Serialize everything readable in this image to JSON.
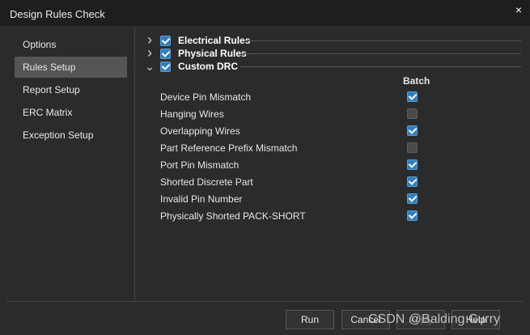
{
  "window": {
    "title": "Design Rules Check",
    "close_glyph": "×"
  },
  "sidebar": {
    "items": [
      {
        "label": "Options"
      },
      {
        "label": "Rules Setup",
        "selected": true
      },
      {
        "label": "Report Setup"
      },
      {
        "label": "ERC Matrix"
      },
      {
        "label": "Exception Setup"
      }
    ]
  },
  "tree": [
    {
      "label": "Electrical Rules",
      "expanded": false,
      "checked": true
    },
    {
      "label": "Physical Rules",
      "expanded": false,
      "checked": true
    },
    {
      "label": "Custom DRC",
      "expanded": true,
      "checked": true
    }
  ],
  "batch_header": "Batch",
  "rules": [
    {
      "label": "Device Pin Mismatch",
      "batch": true
    },
    {
      "label": "Hanging Wires",
      "batch": false
    },
    {
      "label": "Overlapping Wires",
      "batch": true
    },
    {
      "label": "Part Reference Prefix Mismatch",
      "batch": false
    },
    {
      "label": "Port Pin Mismatch",
      "batch": true
    },
    {
      "label": "Shorted Discrete Part",
      "batch": true
    },
    {
      "label": "Invalid Pin Number",
      "batch": true
    },
    {
      "label": "Physically Shorted PACK-SHORT",
      "batch": true
    }
  ],
  "buttons": {
    "run": "Run",
    "cancel": "Cancel",
    "apply": "Apply",
    "help": "Help"
  },
  "watermark": "CSDN @Balding Curry",
  "colors": {
    "checkbox_on": "#2f7fbf",
    "selected_item": "#555555",
    "background": "#2b2b2b"
  }
}
